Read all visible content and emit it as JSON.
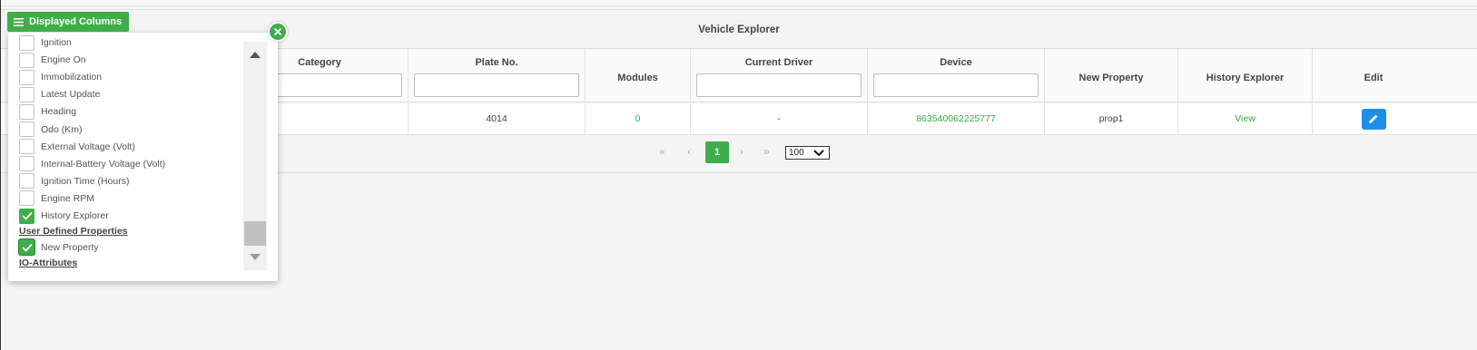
{
  "explorer": {
    "title": "Vehicle Explorer"
  },
  "columns": {
    "category": "Category",
    "plate": "Plate No.",
    "modules": "Modules",
    "driver": "Current Driver",
    "device": "Device",
    "new_property": "New Property",
    "history": "History Explorer",
    "edit": "Edit"
  },
  "row": {
    "plate": "4014",
    "modules": "0",
    "driver": "-",
    "device": "863540062225777",
    "new_property": "prop1",
    "history": "View"
  },
  "pagination": {
    "first": "«",
    "prev": "‹",
    "current": "1",
    "next": "›",
    "last": "»",
    "page_size": "100"
  },
  "popup": {
    "button_label": "Displayed Columns",
    "items": [
      {
        "label": "Ignition",
        "checked": false
      },
      {
        "label": "Engine On",
        "checked": false
      },
      {
        "label": "Immobilization",
        "checked": false
      },
      {
        "label": "Latest Update",
        "checked": false
      },
      {
        "label": "Heading",
        "checked": false
      },
      {
        "label": "Odo (Km)",
        "checked": false
      },
      {
        "label": "External Voltage (Volt)",
        "checked": false
      },
      {
        "label": "Internal-Battery Voltage (Volt)",
        "checked": false
      },
      {
        "label": "Ignition Time (Hours)",
        "checked": false
      },
      {
        "label": "Engine RPM",
        "checked": false
      },
      {
        "label": "History Explorer",
        "checked": true
      }
    ],
    "section_user_defined": "User Defined Properties",
    "user_defined_items": [
      {
        "label": "New Property",
        "checked": true
      }
    ],
    "section_io": "IO-Attributes"
  },
  "colors": {
    "accent_green": "#3fae49",
    "edit_blue": "#1e8fe8",
    "link_green": "#3aa84a"
  }
}
